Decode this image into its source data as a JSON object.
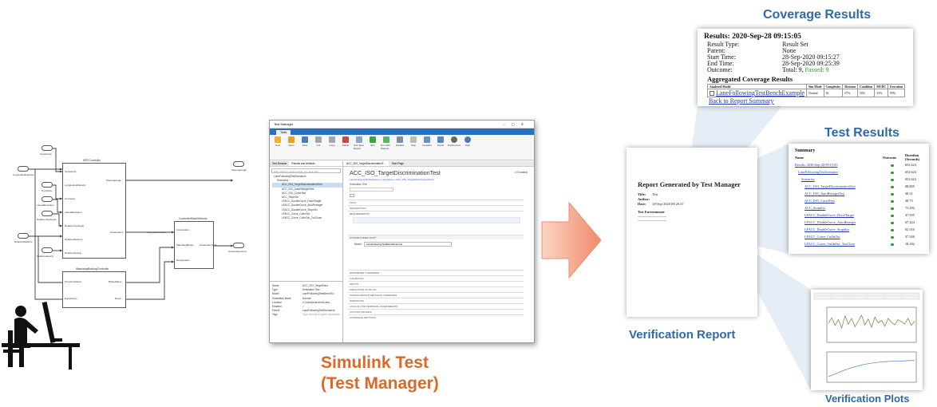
{
  "test_manager": {
    "window_title": "Test Manager",
    "tab": "Tests",
    "ribbon": [
      "New",
      "Open",
      "Save",
      "Cut",
      "Copy",
      "Delete",
      "Test Spec Report",
      "Run",
      "Run with Stepper",
      "Parallel",
      "Stop",
      "Visualize",
      "Import",
      "Preferences",
      "Help"
    ],
    "left_tabs": [
      "Test Browser",
      "Results and Artifacts"
    ],
    "filter_placeholder": "Filter tests by name or tags, e.g. tags: test",
    "tree": [
      "LaneFollowingTestScenarios",
      "Scenarios",
      "ACC_ISO_TargetDiscriminationTest",
      "ACC_ISO_AutoRetargetTest",
      "ACC_ISO_CurveTest",
      "ACC_StopnGo",
      "LFACC_DoubleCurve_DecelTarget",
      "LFACC_DoubleCurve_AutoRetarget",
      "LFACC_DoubleCurve_StopnGo",
      "LFACC_Curve_CutInOut",
      "LFACC_Curve_CutInOut_TooClose"
    ],
    "properties": [
      {
        "k": "Name",
        "v": "ACC_ISO_TargetDiscr"
      },
      {
        "k": "Type",
        "v": "Simulation Test"
      },
      {
        "k": "Model",
        "v": "LaneFollowingTestBenchEx"
      },
      {
        "k": "Simulation Mode",
        "v": "Normal"
      },
      {
        "k": "Location",
        "v": "C:\\Users\\mkrumm\\Lane..."
      },
      {
        "k": "Enabled",
        "v": "✓"
      },
      {
        "k": "Parent",
        "v": "LaneFollowingTestScenarios"
      },
      {
        "k": "Tags",
        "v": "Type comma or space separated"
      }
    ],
    "doc_tabs": [
      "ACC_ISO_TargetDiscriminationT...",
      "Start Page"
    ],
    "test_title": "ACC_ISO_TargetDiscriminationTest",
    "enabled_label": "Enabled",
    "breadcrumb": "LaneFollowingTestScenarios » Scenarios » ACC_ISO_TargetDiscriminationTest",
    "test_type": "Simulation Test",
    "sections": [
      "TAGS",
      "DESCRIPTION",
      "REQUIREMENTS*",
      "SYSTEM UNDER TEST*",
      "PARAMETER OVERRIDES",
      "CALLBACKS",
      "INPUTS",
      "SIMULATION OUTPUTS",
      "CONFIGURATION SETTINGS OVERRIDES",
      "ITERATIONS",
      "LOGICAL AND TEMPORAL ASSESSMENTS",
      "CUSTOM CRITERIA",
      "COVERAGE SETTINGS"
    ],
    "model_label": "Model:",
    "model_value": "LaneFollowingTestBenchExample"
  },
  "captions": {
    "simulink_line1": "Simulink Test",
    "simulink_line2": "(Test Manager)",
    "coverage": "Coverage Results",
    "test_results": "Test Results",
    "verification_report": "Verification Report",
    "verification_plots": "Verification Plots"
  },
  "report": {
    "title": "Report Generated by Test Manager",
    "rows": [
      {
        "k": "Title:",
        "v": "Test"
      },
      {
        "k": "Author:",
        "v": ""
      },
      {
        "k": "Date:",
        "v": "28-Sep-2020 09:26:37"
      }
    ],
    "env_heading": "Test Environment"
  },
  "coverage": {
    "heading": "Results: 2020-Sep-28 09:15:05",
    "rows": [
      {
        "k": "Result Type:",
        "v": "Result Set"
      },
      {
        "k": "Parent:",
        "v": "None"
      },
      {
        "k": "Start Time:",
        "v": "28-Sep-2020 09:15:27"
      },
      {
        "k": "End Time:",
        "v": "28-Sep-2020 09:25:39"
      },
      {
        "k": "Outcome:",
        "v": "Total: 9, ",
        "v2": "Passed: 9"
      }
    ],
    "aggregated": "Aggregated Coverage Results",
    "table_headers": [
      "Analyzed Model",
      "Sim Mode",
      "Complexity",
      "Decision",
      "Condition",
      "MCDC",
      "Execution"
    ],
    "table_row": [
      "LaneFollowingTestBenchExample",
      "Normal",
      "30",
      "67%",
      "50%",
      "33%",
      "99%"
    ],
    "back_link": "Back to Report Summary"
  },
  "test_results": {
    "summary": "Summary",
    "col_name": "Name",
    "col_outcome": "Outcome",
    "col_duration": "Duration (Seconds)",
    "rows": [
      {
        "name": "Results: 2020-Sep-28 09:15:05",
        "indent": 0,
        "duration": "652.623"
      },
      {
        "name": "LaneFollowingTestScenarios",
        "indent": 1,
        "duration": "652.623"
      },
      {
        "name": "Scenarios",
        "indent": 2,
        "duration": "652.623"
      },
      {
        "name": "ACC_ISO_TargetDiscriminationTest",
        "indent": 3,
        "duration": "88.805"
      },
      {
        "name": "ACC_ISO_AutoRetargetTest",
        "indent": 3,
        "duration": "38.31"
      },
      {
        "name": "ACC_ISO_CurveTest",
        "indent": 3,
        "duration": "49.73"
      },
      {
        "name": "ACC_StopnGo",
        "indent": 3,
        "duration": "73.292"
      },
      {
        "name": "LFACC_DoubleCurve_DecelTarget",
        "indent": 3,
        "duration": "47.595"
      },
      {
        "name": "LFACC_DoubleCurve_AutoRetarget",
        "indent": 3,
        "duration": "67.424"
      },
      {
        "name": "LFACC_DoubleCurve_StopnGo",
        "indent": 3,
        "duration": "92.316"
      },
      {
        "name": "LFACC_Curve_CutInOut",
        "indent": 3,
        "duration": "37.326"
      },
      {
        "name": "LFACC_Curve_CutInOut_TooClose",
        "indent": 3,
        "duration": "18.182"
      }
    ]
  },
  "plots": {
    "series": [
      {
        "name": "plot-1",
        "values": [
          0.55,
          0.72,
          0.48,
          0.66,
          0.4,
          0.78,
          0.52,
          0.7,
          0.44,
          0.62,
          0.8,
          0.5,
          0.68,
          0.42,
          0.74,
          0.56,
          0.64,
          0.46,
          0.7,
          0.58,
          0.5,
          0.66,
          0.6,
          0.52,
          0.7,
          0.48,
          0.62
        ]
      },
      {
        "name": "plot-2",
        "values": [
          0.15,
          0.22,
          0.3,
          0.38,
          0.44,
          0.5,
          0.55,
          0.6,
          0.63,
          0.66,
          0.68,
          0.7,
          0.71,
          0.72,
          0.72,
          0.73,
          0.74,
          0.74
        ]
      }
    ]
  },
  "simulink": {
    "blocks": {
      "mpc": "MPCController",
      "mpc_out_label": "SteeringAngle",
      "mpc_acc": "Acceleration",
      "mpc_acc_out": "mpc_acceleration",
      "watchdog": "WatchdogBrakingController",
      "watchdog_out1": "BrakeStatus",
      "watchdog_out2": "Decel",
      "behavior": "ControllerModeSelector",
      "behavior_out": "AccelerationOut",
      "out1": "SteeringAngle",
      "out2": "AccelerationCmd"
    },
    "inputs": [
      {
        "n": "1",
        "label": "SetVelocity"
      },
      {
        "n": "2",
        "label": "LongitudinalVelocity"
      },
      {
        "n": "3",
        "label": "Curvature"
      },
      {
        "n": "4",
        "label": "LateralDeviation"
      },
      {
        "n": "5",
        "label": "RelativeYawAngle"
      },
      {
        "n": "6",
        "label": "RelativeDistance"
      },
      {
        "n": "7",
        "label": "RelativeVelocity"
      }
    ],
    "mpc_ports": [
      "SetVelocity",
      "LongitudinalVelocity",
      "Curvature",
      "LateralDeviation",
      "RelativeYawAngle",
      "RelativeDistance",
      "RelativeVelocity"
    ],
    "watchdog_ports": [
      "TimeToCollision",
      "EgoVelocity"
    ],
    "behavior_ports": [
      "Acceleration",
      "WatchdogBrake",
      "Deceleration"
    ]
  }
}
